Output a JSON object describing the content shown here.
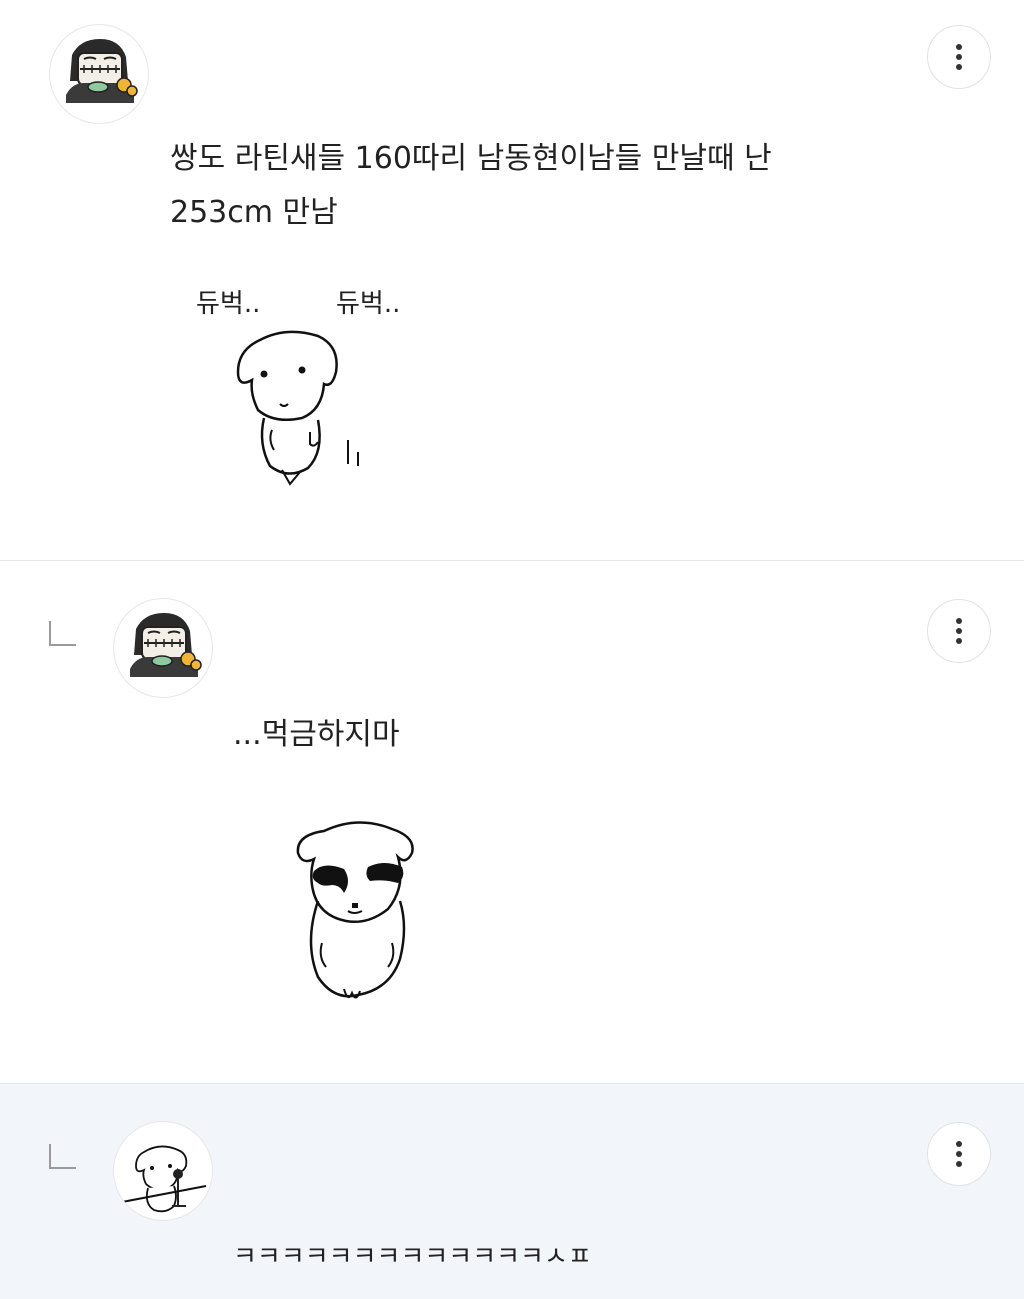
{
  "comments": [
    {
      "text": "쌍도 라틴새들 160따리 남동현이남들 만날때 난\n253cm 만남",
      "sticker_text_left": "듀벅..",
      "sticker_text_right": "듀벅..",
      "avatar_icon": "cartoon-character-avatar-icon",
      "more_icon": "more-vertical-icon"
    },
    {
      "text": "...먹금하지마",
      "avatar_icon": "cartoon-character-avatar-icon",
      "reply_icon": "reply-arrow-icon",
      "more_icon": "more-vertical-icon"
    },
    {
      "text": "ㅋㅋㅋㅋㅋㅋㅋㅋㅋㅋㅋㅋㅋㅅㅍ",
      "avatar_icon": "puppy-avatar-icon",
      "reply_icon": "reply-arrow-icon",
      "more_icon": "more-vertical-icon",
      "highlight_color": "#f2f6fb"
    }
  ]
}
